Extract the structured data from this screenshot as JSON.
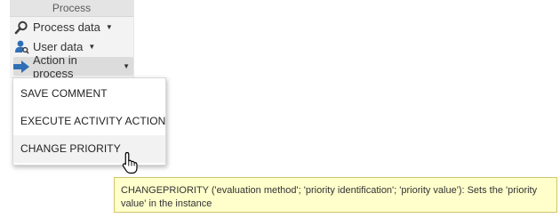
{
  "panel": {
    "header": "Process",
    "buttons": [
      {
        "label": "Process data",
        "icon": "magnifier-icon"
      },
      {
        "label": "User data",
        "icon": "user-search-icon"
      },
      {
        "label": "Action in process",
        "icon": "arrow-right-icon"
      }
    ]
  },
  "dropdown": {
    "items": [
      {
        "label": "SAVE COMMENT"
      },
      {
        "label": "EXECUTE ACTIVITY ACTION"
      },
      {
        "label": "CHANGE PRIORITY"
      }
    ]
  },
  "tooltip": {
    "text": "CHANGEPRIORITY ('evaluation method'; 'priority identification'; 'priority value'): Sets the 'priority value' in the instance"
  },
  "colors": {
    "icon_blue": "#2f6fb5",
    "icon_dark": "#3c3c3c",
    "tooltip_bg": "#ffffcc",
    "tooltip_border": "#d4c46a"
  }
}
